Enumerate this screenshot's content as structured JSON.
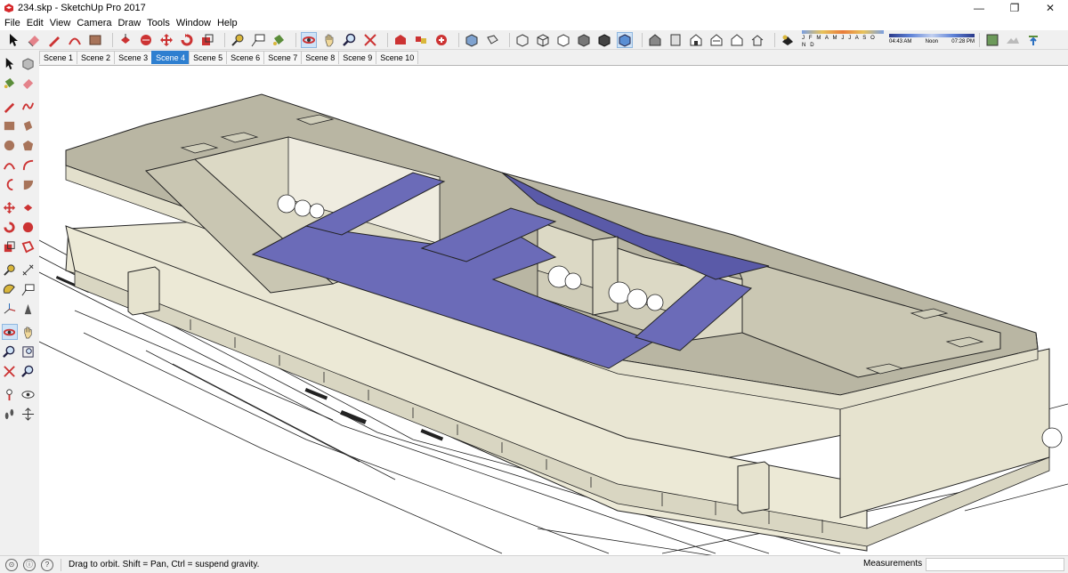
{
  "window": {
    "title": "234.skp - SketchUp Pro 2017",
    "minimize": "—",
    "maximize": "❐",
    "close": "✕"
  },
  "menu": [
    "File",
    "Edit",
    "View",
    "Camera",
    "Draw",
    "Tools",
    "Window",
    "Help"
  ],
  "shadow": {
    "months": "J F M A M J J A S O N D",
    "time_start": "04:43 AM",
    "time_mid": "Noon",
    "time_end": "07:28 PM"
  },
  "scenes": [
    "Scene 1",
    "Scene 2",
    "Scene 3",
    "Scene 4",
    "Scene 5",
    "Scene 6",
    "Scene 7",
    "Scene 8",
    "Scene 9",
    "Scene 10"
  ],
  "active_scene": "Scene 4",
  "status": {
    "hint": "Drag to orbit. Shift = Pan, Ctrl = suspend gravity.",
    "measurements_label": "Measurements",
    "measurements_value": ""
  },
  "colors": {
    "roof_glass": "#6b6bb8",
    "facade": "#e9e6d3",
    "roof": "#b9b6a3",
    "active_tab": "#2e7fd0"
  }
}
